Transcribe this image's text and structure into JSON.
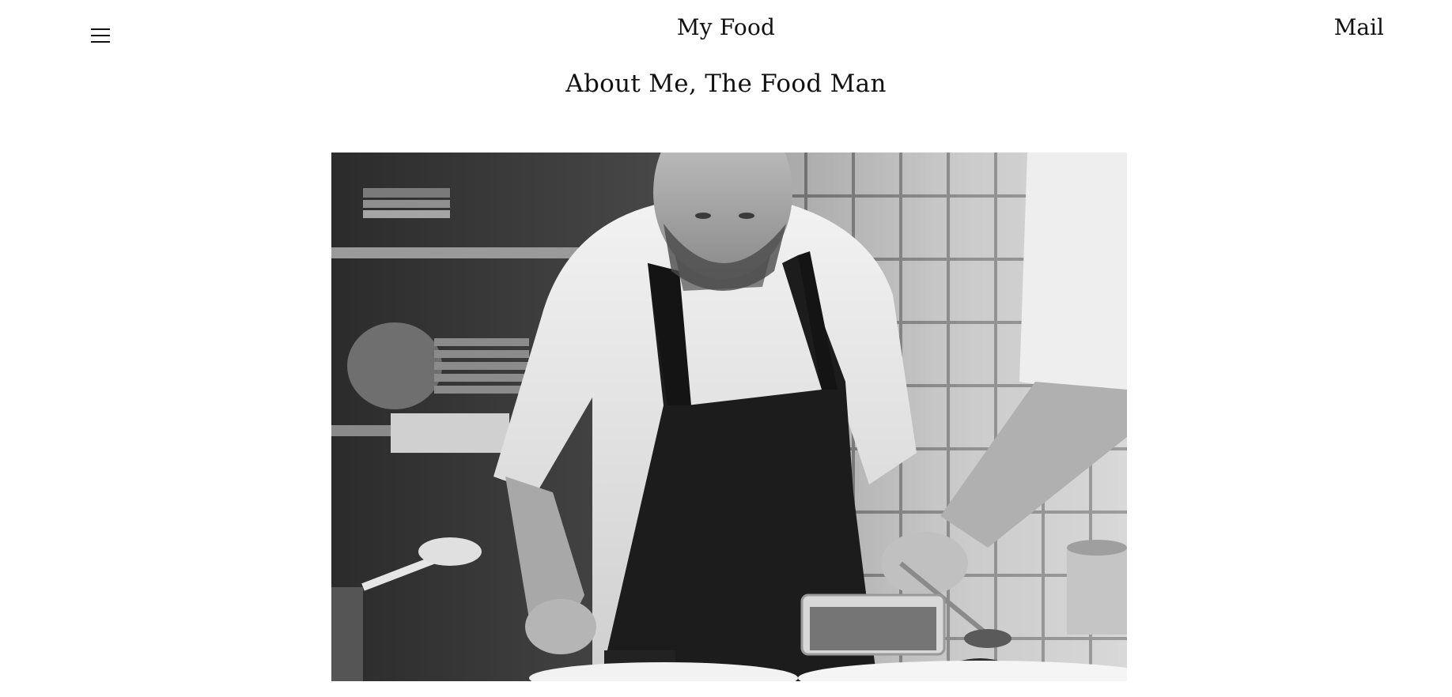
{
  "header": {
    "menu_icon": "hamburger-menu-icon",
    "brand": "My Food",
    "mail_label": "Mail"
  },
  "main": {
    "title": "About Me, The Food Man",
    "hero_image": {
      "description": "Black and white photo of a chef in an apron plating food in a kitchen",
      "style": "grayscale"
    }
  },
  "colors": {
    "background": "#ffffff",
    "text": "#111111"
  }
}
